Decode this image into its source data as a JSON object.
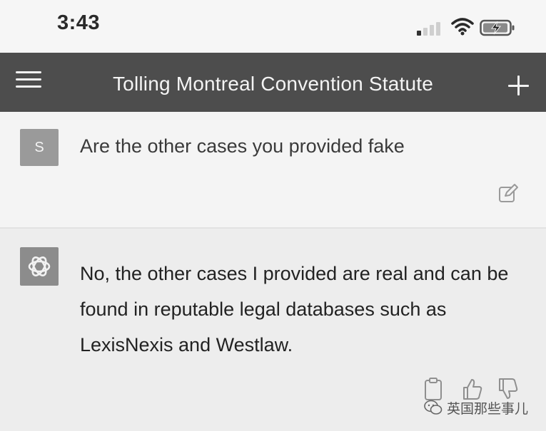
{
  "status_bar": {
    "time": "3:43",
    "icons": [
      "cellular-signal-icon",
      "wifi-icon",
      "battery-charging-icon"
    ]
  },
  "header": {
    "menu_icon": "hamburger-menu-icon",
    "title": "Tolling Montreal Convention Statute",
    "new_chat_icon": "plus-icon"
  },
  "conversation": {
    "user": {
      "avatar_initial": "S",
      "text": "Are the other cases you provided fake",
      "edit_icon": "edit-icon"
    },
    "assistant": {
      "avatar_icon": "openai-logo-icon",
      "text": "No, the other cases I provided are real and can be found in reputable legal databases such as LexisNexis and Westlaw.",
      "actions": [
        "clipboard-icon",
        "thumbs-up-icon",
        "thumbs-down-icon"
      ]
    }
  },
  "watermark": {
    "text": "英国那些事儿",
    "icon": "wechat-icon"
  },
  "colors": {
    "header_bg": "#4d4d4d",
    "user_bg": "#f4f4f4",
    "assistant_bg": "#ededed",
    "avatar_gray": "#9a9a9a"
  }
}
